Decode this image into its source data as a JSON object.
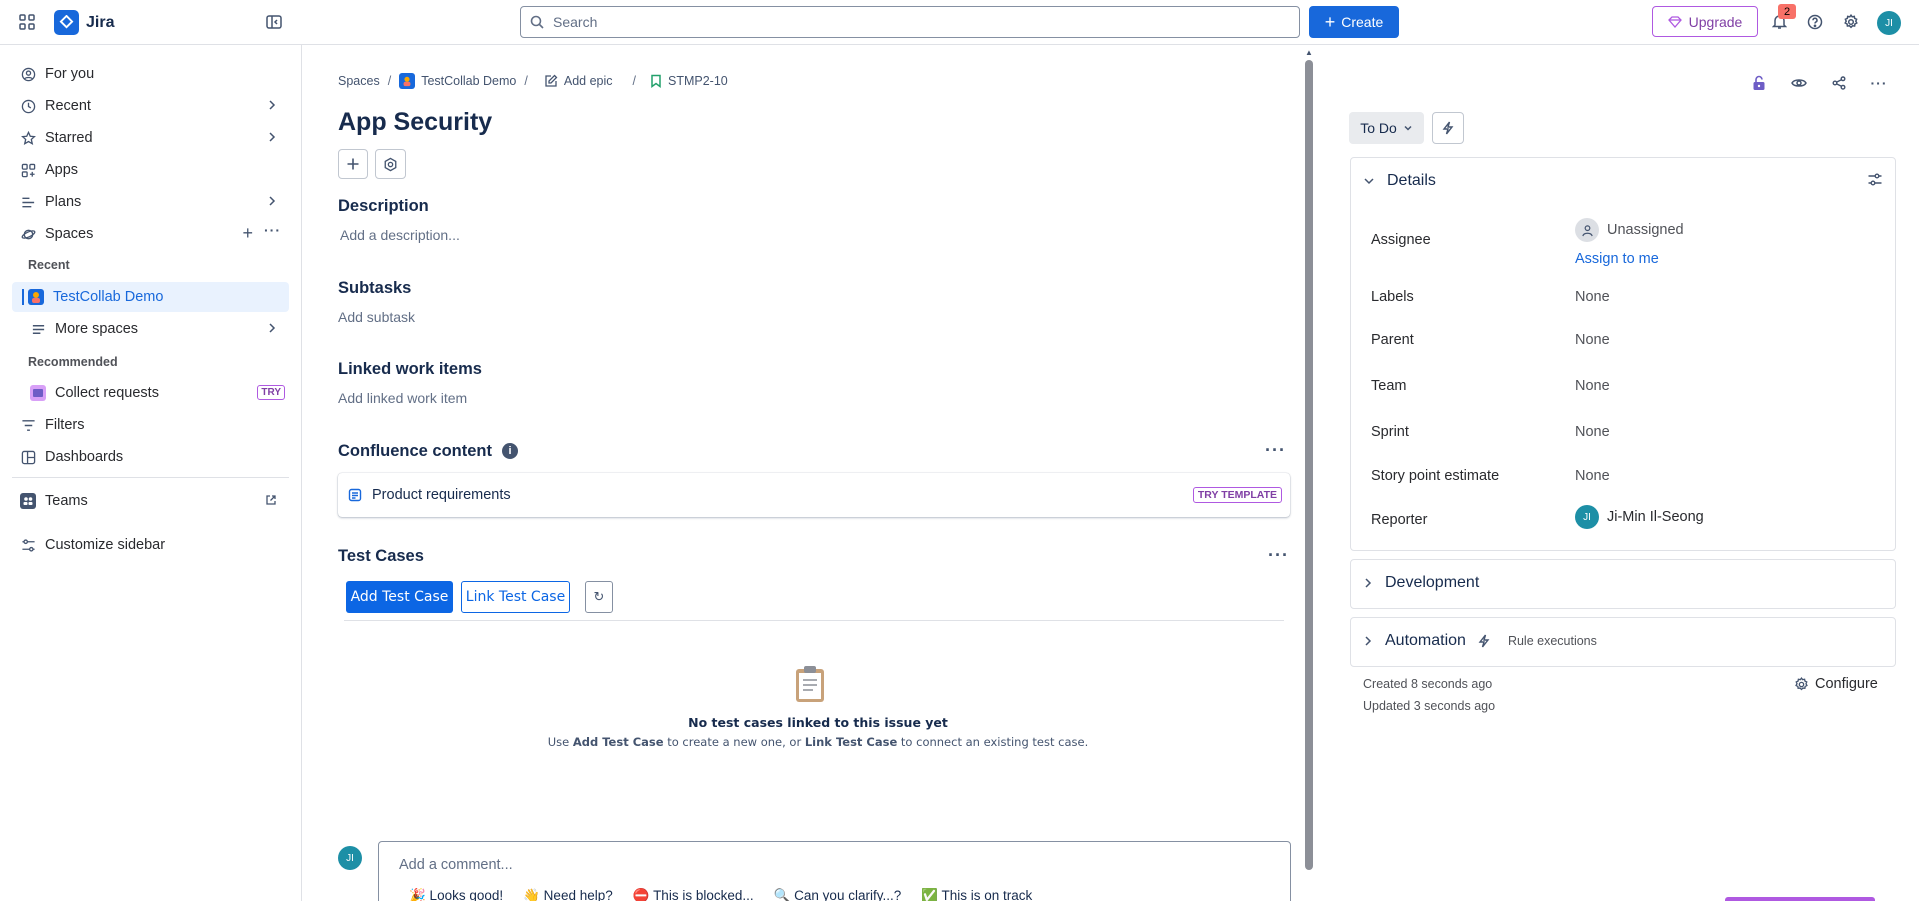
{
  "app": {
    "name": "Jira"
  },
  "search": {
    "placeholder": "Search"
  },
  "topbar": {
    "create_label": "Create",
    "upgrade_label": "Upgrade",
    "notification_count": "2",
    "user_initials": "JI"
  },
  "sidebar": {
    "for_you": "For you",
    "recent": "Recent",
    "starred": "Starred",
    "apps": "Apps",
    "plans": "Plans",
    "spaces": "Spaces",
    "section_recent": "Recent",
    "recent_space": "TestCollab Demo",
    "more_spaces": "More spaces",
    "section_recommended": "Recommended",
    "collect_requests": "Collect requests",
    "try_badge": "TRY",
    "filters": "Filters",
    "dashboards": "Dashboards",
    "teams": "Teams",
    "customize": "Customize sidebar"
  },
  "breadcrumb": {
    "spaces": "Spaces",
    "project": "TestCollab Demo",
    "add_epic": "Add epic",
    "issue_key": "STMP2-10",
    "sep": "/"
  },
  "issue": {
    "title": "App Security",
    "description_title": "Description",
    "description_placeholder": "Add a description...",
    "subtasks_title": "Subtasks",
    "subtasks_add": "Add subtask",
    "linked_title": "Linked work items",
    "linked_add": "Add linked work item",
    "confluence_title": "Confluence content",
    "confluence_item": "Product requirements",
    "try_template": "TRY TEMPLATE",
    "test_cases_title": "Test Cases",
    "add_test_case": "Add Test Case",
    "link_test_case": "Link Test Case",
    "refresh": "↻",
    "empty_title": "No test cases linked to this issue yet",
    "empty_pre": "Use ",
    "empty_b1": "Add Test Case",
    "empty_mid": " to create a new one, or ",
    "empty_b2": "Link Test Case",
    "empty_post": " to connect an existing test case.",
    "comment_placeholder": "Add a comment...",
    "quick_replies": [
      "🎉 Looks good!",
      "👋 Need help?",
      "⛔ This is blocked...",
      "🔍 Can you clarify...?",
      "✅ This is on track"
    ]
  },
  "panel": {
    "status": "To Do",
    "details_title": "Details",
    "assignee_label": "Assignee",
    "assignee_value": "Unassigned",
    "assign_to_me": "Assign to me",
    "labels_label": "Labels",
    "labels_value": "None",
    "parent_label": "Parent",
    "parent_value": "None",
    "team_label": "Team",
    "team_value": "None",
    "sprint_label": "Sprint",
    "sprint_value": "None",
    "story_label": "Story point estimate",
    "story_value": "None",
    "reporter_label": "Reporter",
    "reporter_value": "Ji-Min Il-Seong",
    "reporter_initials": "JI",
    "development_title": "Development",
    "automation_title": "Automation",
    "rule_executions": "Rule executions",
    "created": "Created 8 seconds ago",
    "updated": "Updated 3 seconds ago",
    "configure": "Configure"
  },
  "colors": {
    "brand": "#1868db",
    "border": "#dfe1e6",
    "purple": "#af59e1",
    "avatar": "#1d8fa6"
  }
}
